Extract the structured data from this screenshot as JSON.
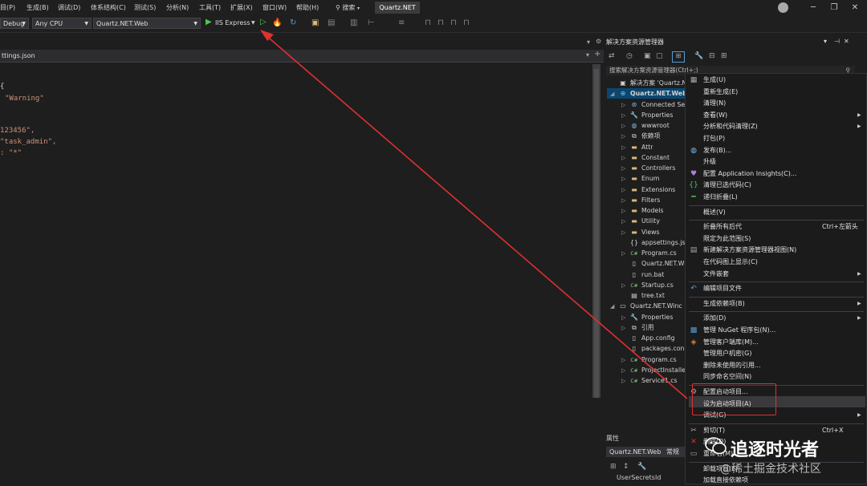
{
  "menubar": {
    "items": [
      "目(P)",
      "生成(B)",
      "调试(D)",
      "体系结构(C)",
      "测试(S)",
      "分析(N)",
      "工具(T)",
      "扩展(X)",
      "窗口(W)",
      "帮助(H)"
    ],
    "search_label": "搜索",
    "project_title": "Quartz.NET"
  },
  "toolbar": {
    "config": "Debug",
    "platform": "Any CPU",
    "startup_project": "Quartz.NET.Web",
    "run_label": "IIS Express"
  },
  "editor": {
    "tab_label": "ttings.json",
    "lines": [
      {
        "text": "{",
        "kind": "plain"
      },
      {
        "text": "\"Warning\"",
        "kind": "str",
        "indent": 1
      },
      {
        "text": "123456\",",
        "kind": "str"
      },
      {
        "text": "\"task_admin\",",
        "kind": "str"
      },
      {
        "text": ": \"*\"",
        "kind": "str"
      }
    ]
  },
  "solution_explorer": {
    "title": "解决方案资源管理器",
    "search_placeholder": "搜索解决方案资源管理器(Ctrl+;)",
    "items": [
      {
        "label": "解决方案 'Quartz.NET",
        "icon": "solution-icon",
        "level": 0
      },
      {
        "label": "Quartz.NET.Web",
        "icon": "web-project-icon",
        "level": 0,
        "expanded": true,
        "selected": true
      },
      {
        "label": "Connected Se",
        "icon": "connected-services-icon",
        "level": 1
      },
      {
        "label": "Properties",
        "icon": "wrench-icon",
        "level": 1
      },
      {
        "label": "wwwroot",
        "icon": "globe-icon",
        "level": 1
      },
      {
        "label": "依赖项",
        "icon": "dependencies-icon",
        "level": 1
      },
      {
        "label": "Attr",
        "icon": "folder-icon",
        "level": 1
      },
      {
        "label": "Constant",
        "icon": "folder-icon",
        "level": 1
      },
      {
        "label": "Controllers",
        "icon": "folder-icon",
        "level": 1
      },
      {
        "label": "Enum",
        "icon": "folder-icon",
        "level": 1
      },
      {
        "label": "Extensions",
        "icon": "folder-icon",
        "level": 1
      },
      {
        "label": "Filters",
        "icon": "folder-icon",
        "level": 1
      },
      {
        "label": "Models",
        "icon": "folder-icon",
        "level": 1
      },
      {
        "label": "Utility",
        "icon": "folder-icon",
        "level": 1
      },
      {
        "label": "Views",
        "icon": "folder-icon",
        "level": 1
      },
      {
        "label": "appsettings.js",
        "icon": "json-file-icon",
        "level": 1
      },
      {
        "label": "Program.cs",
        "icon": "csharp-file-icon",
        "level": 1
      },
      {
        "label": "Quartz.NET.W",
        "icon": "file-icon",
        "level": 1
      },
      {
        "label": "run.bat",
        "icon": "file-icon",
        "level": 1
      },
      {
        "label": "Startup.cs",
        "icon": "csharp-file-icon",
        "level": 1
      },
      {
        "label": "tree.txt",
        "icon": "text-file-icon",
        "level": 1
      },
      {
        "label": "Quartz.NET.Winc",
        "icon": "windows-project-icon",
        "level": 0,
        "expanded": true
      },
      {
        "label": "Properties",
        "icon": "wrench-icon",
        "level": 1
      },
      {
        "label": "引用",
        "icon": "references-icon",
        "level": 1
      },
      {
        "label": "App.config",
        "icon": "config-file-icon",
        "level": 1
      },
      {
        "label": "packages.con",
        "icon": "config-file-icon",
        "level": 1
      },
      {
        "label": "Program.cs",
        "icon": "csharp-file-icon",
        "level": 1
      },
      {
        "label": "ProjectInstalle",
        "icon": "csharp-file-icon",
        "level": 1
      },
      {
        "label": "Service1.cs",
        "icon": "csharp-file-icon",
        "level": 1
      }
    ]
  },
  "properties": {
    "header": "属性",
    "project": "Quartz.NET.Web",
    "tab": "常规",
    "row_label": "UserSecretsId"
  },
  "context_menu": {
    "items": [
      {
        "label": "生成(U)",
        "icon": "build-icon"
      },
      {
        "label": "重新生成(E)"
      },
      {
        "label": "清理(N)"
      },
      {
        "label": "查看(W)",
        "submenu": true
      },
      {
        "label": "分析和代码清理(Z)",
        "submenu": true
      },
      {
        "label": "打包(P)"
      },
      {
        "label": "发布(B)...",
        "icon": "publish-globe-icon"
      },
      {
        "label": "升级"
      },
      {
        "label": "配置 Application Insights(C)...",
        "icon": "insights-icon"
      },
      {
        "label": "清理已选代码(C)",
        "icon": "braces-icon"
      },
      {
        "label": "递归折叠(L)",
        "icon": "collapse-icon"
      },
      {
        "label": "概述(V)",
        "separator_before": true
      },
      {
        "label": "折叠所有后代",
        "shortcut": "Ctrl+左箭头",
        "separator_before": true
      },
      {
        "label": "限定为此范围(S)"
      },
      {
        "label": "新建解决方案资源管理器视图(N)",
        "icon": "new-view-icon"
      },
      {
        "label": "在代码图上显示(C)"
      },
      {
        "label": "文件嵌套",
        "submenu": true
      },
      {
        "label": "编辑项目文件",
        "icon": "edit-arrow-icon",
        "separator_before": true
      },
      {
        "label": "生成依赖项(B)",
        "submenu": true,
        "separator_before": true
      },
      {
        "label": "添加(D)",
        "submenu": true,
        "separator_before": true
      },
      {
        "label": "管理 NuGet 程序包(N)...",
        "icon": "nuget-icon"
      },
      {
        "label": "管理客户端库(M)...",
        "icon": "client-lib-icon"
      },
      {
        "label": "管理用户机密(G)"
      },
      {
        "label": "删除未使用的引用..."
      },
      {
        "label": "同步命名空间(N)"
      },
      {
        "label": "配置启动项目...",
        "icon": "gear-icon",
        "separator_before": true
      },
      {
        "label": "设为启动项目(A)",
        "highlighted": true
      },
      {
        "label": "调试(G)",
        "submenu": true
      },
      {
        "label": "剪切(T)",
        "shortcut": "Ctrl+X",
        "icon": "scissors-icon",
        "separator_before": true
      },
      {
        "label": "删除(D)",
        "icon": "delete-x-icon"
      },
      {
        "label": "重命名(M)",
        "icon": "rename-icon"
      },
      {
        "label": "卸载项目(L)",
        "separator_before": true
      },
      {
        "label": "加载直接依赖项"
      }
    ]
  },
  "watermark": {
    "main": "追逐时光者",
    "sub": "@稀土掘金技术社区"
  },
  "colors": {
    "annotation_red": "#e03030",
    "run_green": "#4ec94e",
    "selection_blue": "#094771"
  }
}
